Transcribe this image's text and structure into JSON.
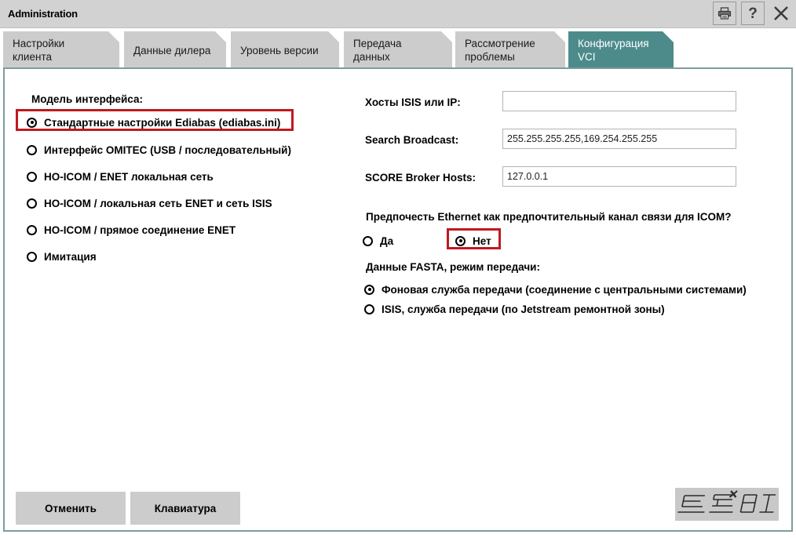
{
  "window": {
    "title": "Administration",
    "buttons": [
      {
        "name": "print-icon",
        "label": "Print"
      },
      {
        "name": "help-icon",
        "label": "?"
      },
      {
        "name": "close-icon",
        "label": "Close"
      }
    ]
  },
  "tabs": [
    {
      "label": "Настройки\nклиента",
      "active": false
    },
    {
      "label": "Данные дилера",
      "active": false
    },
    {
      "label": "Уровень версии",
      "active": false
    },
    {
      "label": "Передача\nданных",
      "active": false
    },
    {
      "label": "Рассмотрение\nпроблемы",
      "active": false
    },
    {
      "label": "Конфигурация\nVCI",
      "active": true
    }
  ],
  "interface_model": {
    "title": "Модель интерфейса:",
    "options": [
      {
        "label": "Стандартные настройки Ediabas (ediabas.ini)",
        "selected": true,
        "highlighted": true
      },
      {
        "label": "Интерфейс OMITEC (USB / последовательный)",
        "selected": false,
        "highlighted": false
      },
      {
        "label": "HO-ICOM / ENET локальная сеть",
        "selected": false,
        "highlighted": false
      },
      {
        "label": "HO-ICOM / локальная сеть ENET и сеть ISIS",
        "selected": false,
        "highlighted": false
      },
      {
        "label": "HO-ICOM / прямое соединение ENET",
        "selected": false,
        "highlighted": false
      },
      {
        "label": "Имитация",
        "selected": false,
        "highlighted": false
      }
    ]
  },
  "network_fields": [
    {
      "label": "Хосты ISIS или IP:",
      "value": "",
      "placeholder": ""
    },
    {
      "label": "Search Broadcast:",
      "value": "255.255.255.255,169.254.255.255",
      "placeholder": ""
    },
    {
      "label": "SCORE Broker Hosts:",
      "value": "127.0.0.1",
      "placeholder": ""
    }
  ],
  "ethernet_preference": {
    "question": "Предпочесть Ethernet как предпочтительный канал связи для ICOM?",
    "options": [
      {
        "label": "Да",
        "selected": false,
        "highlighted": false
      },
      {
        "label": "Нет",
        "selected": true,
        "highlighted": true
      }
    ]
  },
  "fasta": {
    "title": "Данные FASTA, режим передачи:",
    "options": [
      {
        "label": "Фоновая служба передачи (соединение с центральными системами)",
        "selected": true
      },
      {
        "label": "ISIS, служба передачи (по Jetstream ремонтной зоны)",
        "selected": false
      }
    ]
  },
  "footer": {
    "cancel_label": "Отменить",
    "keyboard_label": "Клавиатура"
  },
  "colors": {
    "titlebar": "#d2d2d2",
    "tab_inactive": "#cccccc",
    "tab_active": "#4d8b8b",
    "panel_border": "#7e9c9c",
    "highlight_red": "#c11920",
    "button_face": "#cccccc"
  }
}
